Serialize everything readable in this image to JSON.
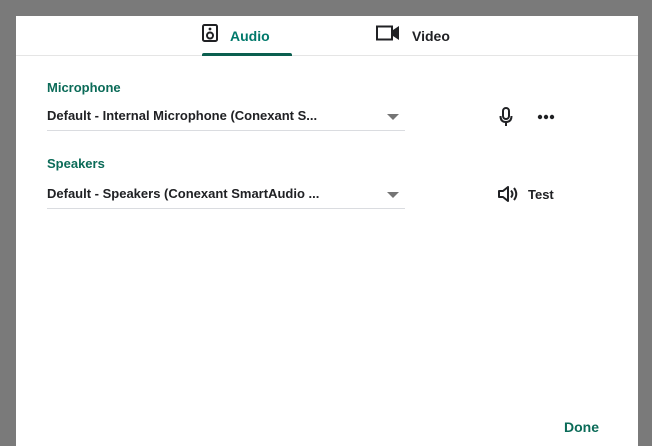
{
  "tabs": [
    {
      "label": "Audio",
      "icon": "speaker-box-icon",
      "active": true
    },
    {
      "label": "Video",
      "icon": "videocam-icon",
      "active": false
    }
  ],
  "microphone": {
    "section_label": "Microphone",
    "selected": "Default - Internal Microphone (Conexant S...",
    "icons": [
      "mic-icon",
      "more-icon"
    ]
  },
  "speakers": {
    "section_label": "Speakers",
    "selected": "Default - Speakers (Conexant SmartAudio ...",
    "test_label": "Test"
  },
  "footer": {
    "done_label": "Done"
  },
  "colors": {
    "accent": "#0b6b58",
    "frame": "#7a7a7a",
    "text": "#202124"
  }
}
